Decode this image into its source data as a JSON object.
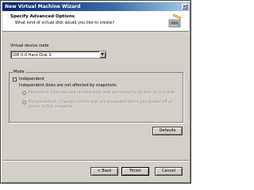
{
  "window": {
    "title": "New Virtual Machine Wizard",
    "close_glyph": "×"
  },
  "header": {
    "title": "Specify Advanced Options",
    "subtitle": "What kind of virtual disk would you like to create?",
    "icon": "wizard-disk-icon"
  },
  "device": {
    "label": "Virtual device node",
    "selected": "IDE 0:0  Hard Disk 0",
    "arrow_glyph": "▼"
  },
  "mode": {
    "legend": "Mode",
    "independent_label": "Independent",
    "independent_desc": "Independent disks are not affected by snapshots.",
    "persistent_label": "Persistent: Changes are immediately and permanently written to the disk.",
    "nonpersistent_label": "Nonpersistent: Changes to the disk are discarded when you power off or revert to the snapshot."
  },
  "buttons": {
    "defaults": "Defaults",
    "back": "< Back",
    "finish": "Finish",
    "cancel": "Cancel"
  }
}
